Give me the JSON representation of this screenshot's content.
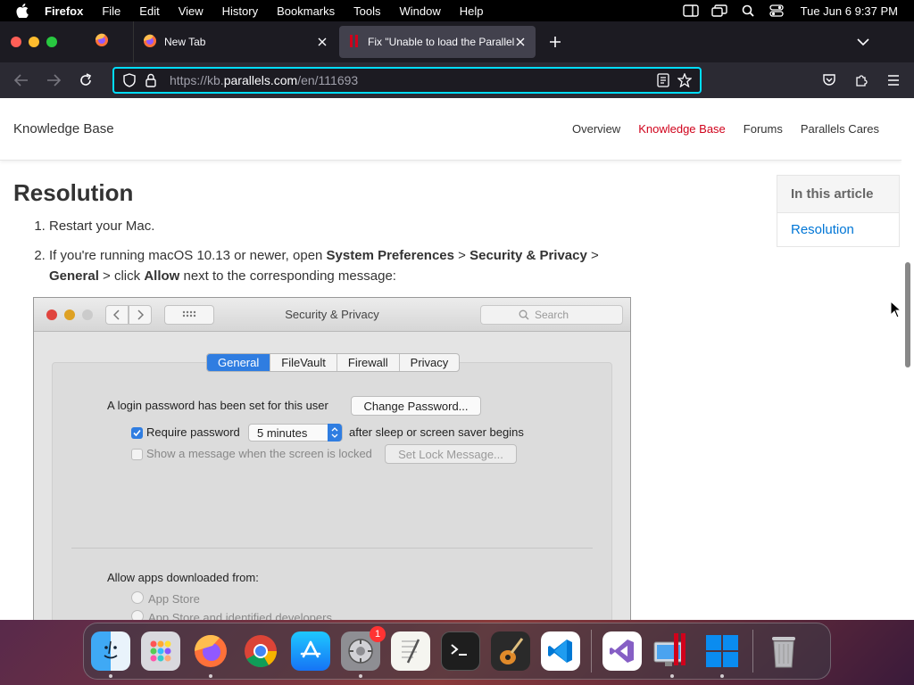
{
  "menubar": {
    "app_name": "Firefox",
    "items": [
      "File",
      "Edit",
      "View",
      "History",
      "Bookmarks",
      "Tools",
      "Window",
      "Help"
    ],
    "clock": "Tue Jun 6  9:37 PM"
  },
  "browser": {
    "tabs": [
      {
        "title": "New Tab"
      },
      {
        "title": "Fix \"Unable to load the Parallels"
      }
    ],
    "url": {
      "prefix": "https://kb.",
      "domain": "parallels.com",
      "path": "/en/111693"
    }
  },
  "site": {
    "header_title": "Knowledge Base",
    "nav": [
      "Overview",
      "Knowledge Base",
      "Forums",
      "Parallels Cares"
    ]
  },
  "article": {
    "heading": "Resolution",
    "step1": "Restart your Mac.",
    "step2": {
      "t1": "If you're running macOS 10.13 or newer, open ",
      "b1": "System Preferences",
      "t2": " > ",
      "b2": "Security & Privacy",
      "t3": " > ",
      "b3": "General",
      "t4": " > click ",
      "b4": "Allow",
      "t5": " next to the corresponding message:"
    }
  },
  "toc": {
    "heading": "In this article",
    "link": "Resolution"
  },
  "screenshot": {
    "title": "Security & Privacy",
    "search_placeholder": "Search",
    "tabs": [
      "General",
      "FileVault",
      "Firewall",
      "Privacy"
    ],
    "login_label": "A login password has been set for this user",
    "change_password": "Change Password...",
    "require_password": "Require password",
    "delay_value": "5 minutes",
    "after_sleep": "after sleep or screen saver begins",
    "show_message": "Show a message when the screen is locked",
    "set_lock_message": "Set Lock Message...",
    "allow_apps": "Allow apps downloaded from:",
    "option_app_store": "App Store",
    "option_identified": "App Store and identified developers"
  },
  "dock": {
    "apps": [
      "Finder",
      "Launchpad",
      "Firefox",
      "Chrome",
      "App Store",
      "System Preferences",
      "TextEdit",
      "Terminal",
      "GarageBand",
      "VS Code",
      "Visual Studio",
      "Parallels Desktop",
      "Windows 11",
      "Trash"
    ],
    "settings_badge": "1"
  }
}
